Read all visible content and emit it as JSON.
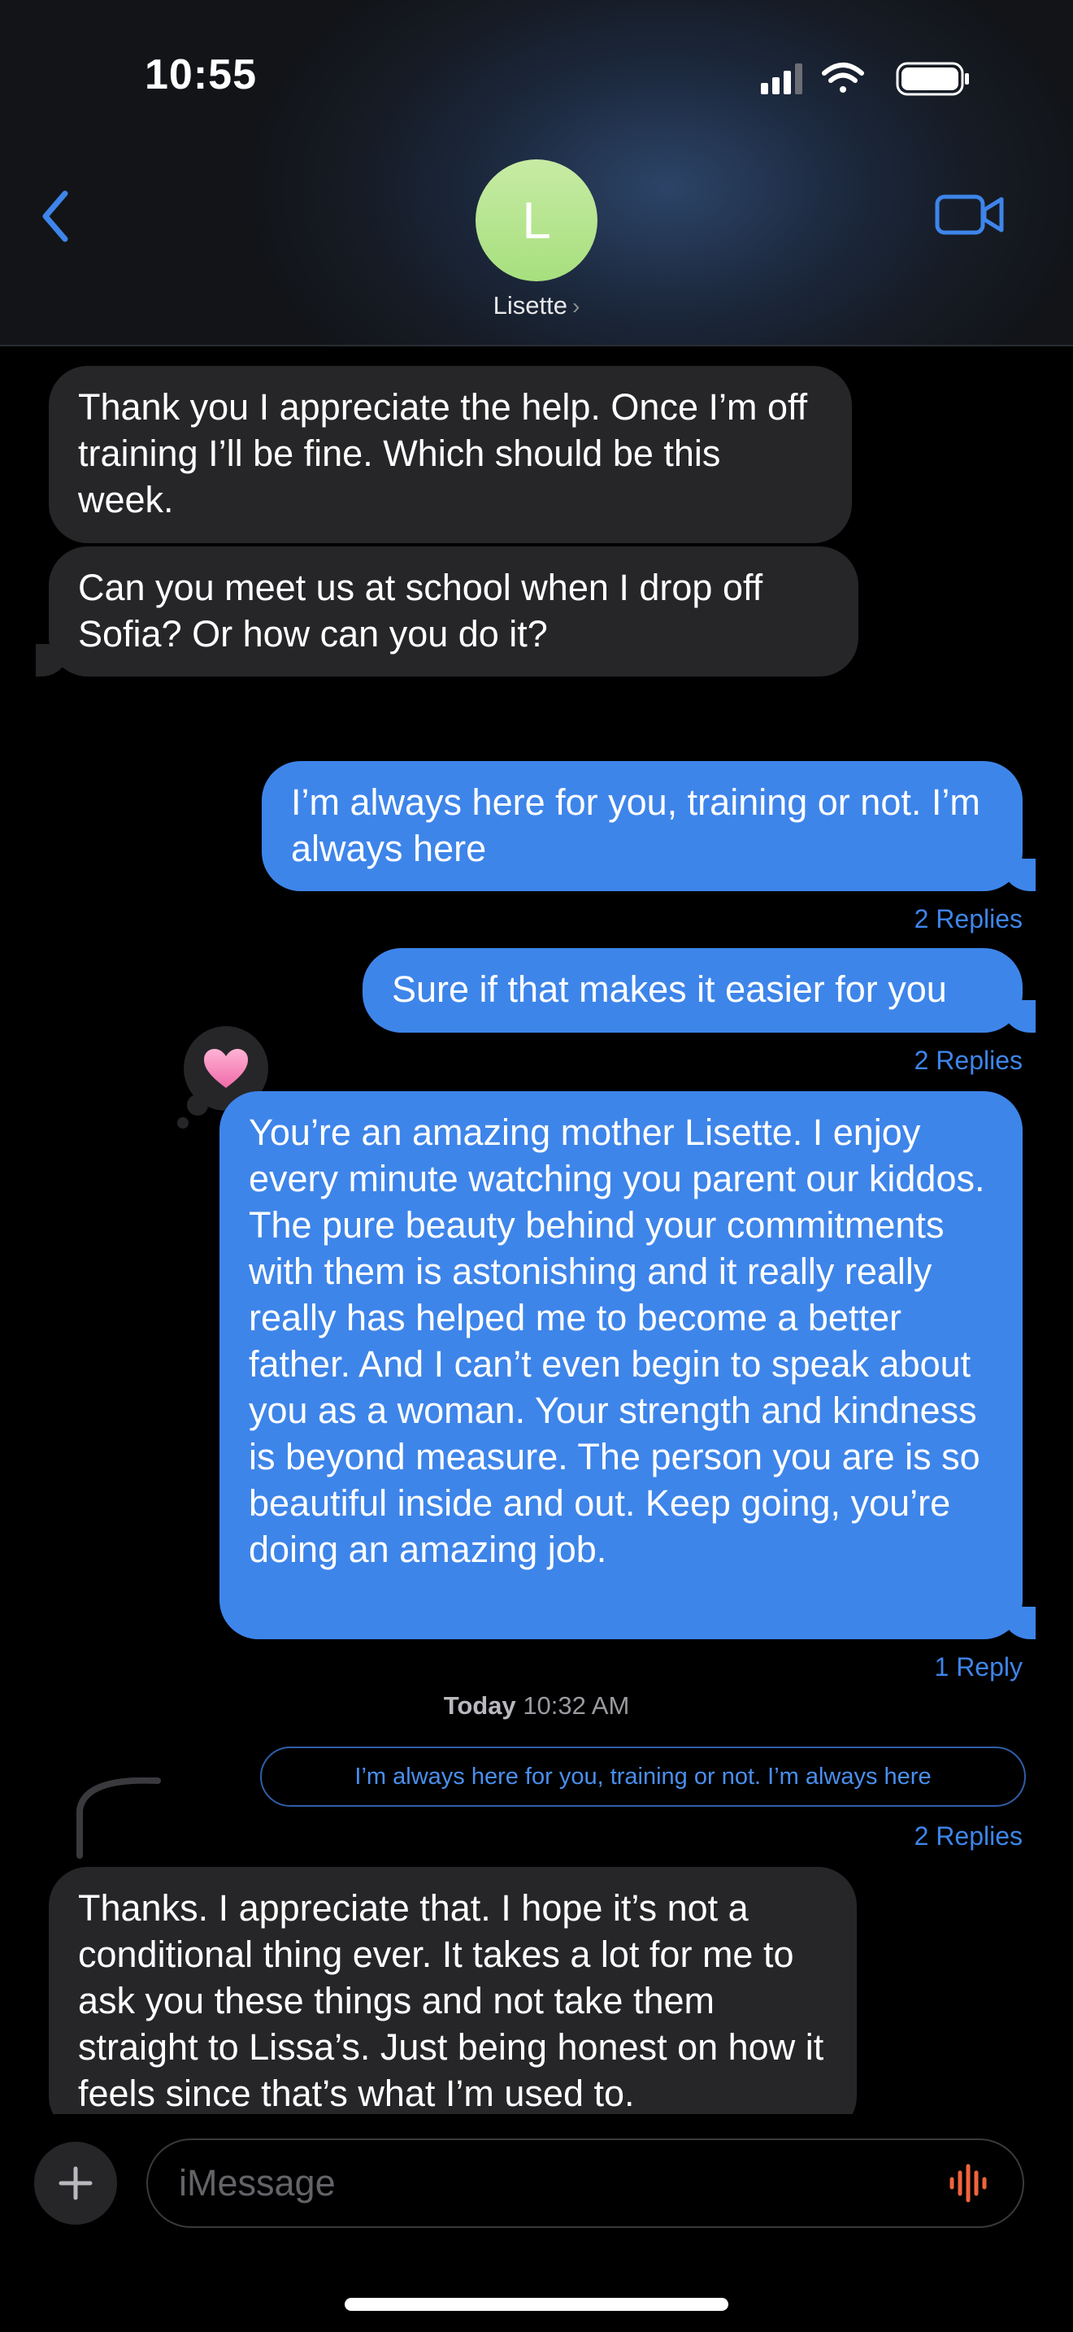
{
  "status_bar": {
    "time": "10:55"
  },
  "header": {
    "avatar_initial": "L",
    "contact_name": "Lisette",
    "chevron": "›"
  },
  "messages": [
    {
      "direction": "incoming",
      "text": "Thank you I appreciate the help. Once I’m off training I’ll be fine. Which should be this week."
    },
    {
      "direction": "incoming",
      "text": "Can you meet us at school when I drop off Sofia? Or how can you do it?"
    },
    {
      "direction": "outgoing",
      "text": "I’m always here for you, training or not.  I’m always here",
      "replies": "2 Replies"
    },
    {
      "direction": "outgoing",
      "text": "Sure if that makes it easier for you",
      "replies": "2 Replies"
    },
    {
      "direction": "outgoing",
      "text": "You’re an amazing mother Lisette.  I enjoy every minute watching you parent our kiddos.  The pure beauty behind your commitments with them is astonishing and it really really really has helped me to become a better father.  And I can’t even begin to speak about you as a woman.  Your strength and kindness is beyond measure.  The person you are is so beautiful inside and out.  Keep going, you’re doing an amazing job.",
      "replies": "1 Reply",
      "reaction": "pink-heart"
    },
    {
      "direction": "incoming",
      "text": "Thanks. I appreciate that. I hope it’s not a conditional thing ever. It takes a lot for me to ask you these things and not take them straight to Lissa’s. Just being honest on how it feels since that’s what I’m used to."
    }
  ],
  "timestamp": {
    "day": "Today",
    "time": "10:32 AM"
  },
  "thread_quote": {
    "text": "I’m always here for you, training or not.  I’m always here",
    "replies": "2 Replies"
  },
  "composer": {
    "placeholder": "iMessage"
  },
  "colors": {
    "accent": "#3E85EA",
    "incoming_bubble": "#262628",
    "avatar": "#B5E58F",
    "mic": "#F0643C"
  },
  "icons": [
    "back-chevron-icon",
    "video-camera-icon",
    "signal-icon",
    "wifi-icon",
    "battery-icon",
    "plus-icon",
    "audio-waveform-icon",
    "heart-reaction-icon"
  ]
}
